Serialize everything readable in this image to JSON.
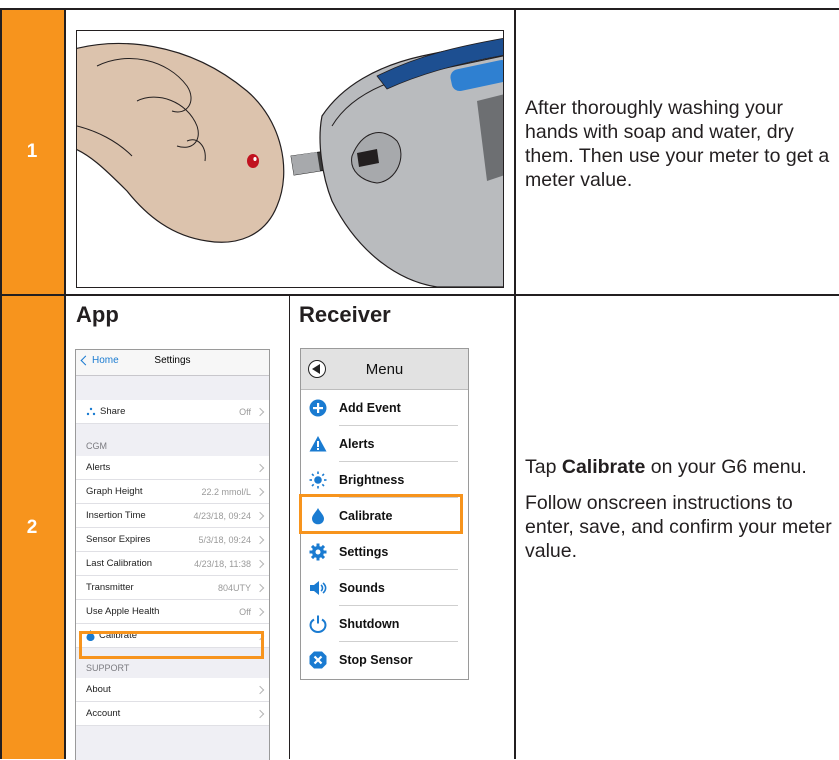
{
  "steps": [
    {
      "number": "1",
      "text": "After thoroughly washing your hands with soap and water, dry them. Then use your meter to get a meter value."
    },
    {
      "number": "2",
      "text_prefix": "Tap ",
      "text_bold": "Calibrate",
      "text_suffix": " on your G6 menu.",
      "text2": "Follow onscreen instructions to enter, save, and confirm your meter value."
    }
  ],
  "columns": {
    "app": "App",
    "receiver": "Receiver"
  },
  "app": {
    "back_label": "Home",
    "title": "Settings",
    "share": {
      "label": "Share",
      "value": "Off"
    },
    "cgm_header": "CGM",
    "rows": [
      {
        "label": "Alerts",
        "value": ""
      },
      {
        "label": "Graph Height",
        "value": "22.2 mmol/L"
      },
      {
        "label": "Insertion Time",
        "value": "4/23/18, 09:24"
      },
      {
        "label": "Sensor Expires",
        "value": "5/3/18, 09:24"
      },
      {
        "label": "Last Calibration",
        "value": "4/23/18, 11:38"
      },
      {
        "label": "Transmitter",
        "value": "804UTY"
      },
      {
        "label": "Use Apple Health",
        "value": "Off"
      },
      {
        "label": "Calibrate",
        "value": ""
      }
    ],
    "support_header": "SUPPORT",
    "support_rows": [
      {
        "label": "About"
      },
      {
        "label": "Account"
      }
    ]
  },
  "receiver": {
    "title": "Menu",
    "items": [
      {
        "label": "Add Event",
        "icon": "plus-circle-icon"
      },
      {
        "label": "Alerts",
        "icon": "warning-icon"
      },
      {
        "label": "Brightness",
        "icon": "sun-icon"
      },
      {
        "label": "Calibrate",
        "icon": "drop-icon"
      },
      {
        "label": "Settings",
        "icon": "gear-icon"
      },
      {
        "label": "Sounds",
        "icon": "speaker-icon"
      },
      {
        "label": "Shutdown",
        "icon": "power-icon"
      },
      {
        "label": "Stop Sensor",
        "icon": "stop-x-icon"
      }
    ]
  },
  "colors": {
    "accent": "#f7941d",
    "icon_blue": "#1a7bd1",
    "border": "#231f20"
  }
}
